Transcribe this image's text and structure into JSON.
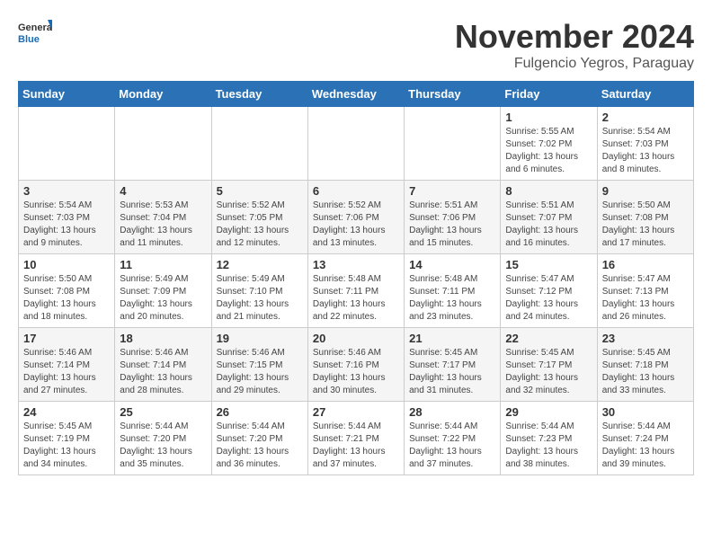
{
  "logo": {
    "general": "General",
    "blue": "Blue"
  },
  "title": {
    "month": "November 2024",
    "location": "Fulgencio Yegros, Paraguay"
  },
  "weekdays": [
    "Sunday",
    "Monday",
    "Tuesday",
    "Wednesday",
    "Thursday",
    "Friday",
    "Saturday"
  ],
  "weeks": [
    [
      {
        "day": "",
        "info": ""
      },
      {
        "day": "",
        "info": ""
      },
      {
        "day": "",
        "info": ""
      },
      {
        "day": "",
        "info": ""
      },
      {
        "day": "",
        "info": ""
      },
      {
        "day": "1",
        "info": "Sunrise: 5:55 AM\nSunset: 7:02 PM\nDaylight: 13 hours and 6 minutes."
      },
      {
        "day": "2",
        "info": "Sunrise: 5:54 AM\nSunset: 7:03 PM\nDaylight: 13 hours and 8 minutes."
      }
    ],
    [
      {
        "day": "3",
        "info": "Sunrise: 5:54 AM\nSunset: 7:03 PM\nDaylight: 13 hours and 9 minutes."
      },
      {
        "day": "4",
        "info": "Sunrise: 5:53 AM\nSunset: 7:04 PM\nDaylight: 13 hours and 11 minutes."
      },
      {
        "day": "5",
        "info": "Sunrise: 5:52 AM\nSunset: 7:05 PM\nDaylight: 13 hours and 12 minutes."
      },
      {
        "day": "6",
        "info": "Sunrise: 5:52 AM\nSunset: 7:06 PM\nDaylight: 13 hours and 13 minutes."
      },
      {
        "day": "7",
        "info": "Sunrise: 5:51 AM\nSunset: 7:06 PM\nDaylight: 13 hours and 15 minutes."
      },
      {
        "day": "8",
        "info": "Sunrise: 5:51 AM\nSunset: 7:07 PM\nDaylight: 13 hours and 16 minutes."
      },
      {
        "day": "9",
        "info": "Sunrise: 5:50 AM\nSunset: 7:08 PM\nDaylight: 13 hours and 17 minutes."
      }
    ],
    [
      {
        "day": "10",
        "info": "Sunrise: 5:50 AM\nSunset: 7:08 PM\nDaylight: 13 hours and 18 minutes."
      },
      {
        "day": "11",
        "info": "Sunrise: 5:49 AM\nSunset: 7:09 PM\nDaylight: 13 hours and 20 minutes."
      },
      {
        "day": "12",
        "info": "Sunrise: 5:49 AM\nSunset: 7:10 PM\nDaylight: 13 hours and 21 minutes."
      },
      {
        "day": "13",
        "info": "Sunrise: 5:48 AM\nSunset: 7:11 PM\nDaylight: 13 hours and 22 minutes."
      },
      {
        "day": "14",
        "info": "Sunrise: 5:48 AM\nSunset: 7:11 PM\nDaylight: 13 hours and 23 minutes."
      },
      {
        "day": "15",
        "info": "Sunrise: 5:47 AM\nSunset: 7:12 PM\nDaylight: 13 hours and 24 minutes."
      },
      {
        "day": "16",
        "info": "Sunrise: 5:47 AM\nSunset: 7:13 PM\nDaylight: 13 hours and 26 minutes."
      }
    ],
    [
      {
        "day": "17",
        "info": "Sunrise: 5:46 AM\nSunset: 7:14 PM\nDaylight: 13 hours and 27 minutes."
      },
      {
        "day": "18",
        "info": "Sunrise: 5:46 AM\nSunset: 7:14 PM\nDaylight: 13 hours and 28 minutes."
      },
      {
        "day": "19",
        "info": "Sunrise: 5:46 AM\nSunset: 7:15 PM\nDaylight: 13 hours and 29 minutes."
      },
      {
        "day": "20",
        "info": "Sunrise: 5:46 AM\nSunset: 7:16 PM\nDaylight: 13 hours and 30 minutes."
      },
      {
        "day": "21",
        "info": "Sunrise: 5:45 AM\nSunset: 7:17 PM\nDaylight: 13 hours and 31 minutes."
      },
      {
        "day": "22",
        "info": "Sunrise: 5:45 AM\nSunset: 7:17 PM\nDaylight: 13 hours and 32 minutes."
      },
      {
        "day": "23",
        "info": "Sunrise: 5:45 AM\nSunset: 7:18 PM\nDaylight: 13 hours and 33 minutes."
      }
    ],
    [
      {
        "day": "24",
        "info": "Sunrise: 5:45 AM\nSunset: 7:19 PM\nDaylight: 13 hours and 34 minutes."
      },
      {
        "day": "25",
        "info": "Sunrise: 5:44 AM\nSunset: 7:20 PM\nDaylight: 13 hours and 35 minutes."
      },
      {
        "day": "26",
        "info": "Sunrise: 5:44 AM\nSunset: 7:20 PM\nDaylight: 13 hours and 36 minutes."
      },
      {
        "day": "27",
        "info": "Sunrise: 5:44 AM\nSunset: 7:21 PM\nDaylight: 13 hours and 37 minutes."
      },
      {
        "day": "28",
        "info": "Sunrise: 5:44 AM\nSunset: 7:22 PM\nDaylight: 13 hours and 37 minutes."
      },
      {
        "day": "29",
        "info": "Sunrise: 5:44 AM\nSunset: 7:23 PM\nDaylight: 13 hours and 38 minutes."
      },
      {
        "day": "30",
        "info": "Sunrise: 5:44 AM\nSunset: 7:24 PM\nDaylight: 13 hours and 39 minutes."
      }
    ]
  ]
}
